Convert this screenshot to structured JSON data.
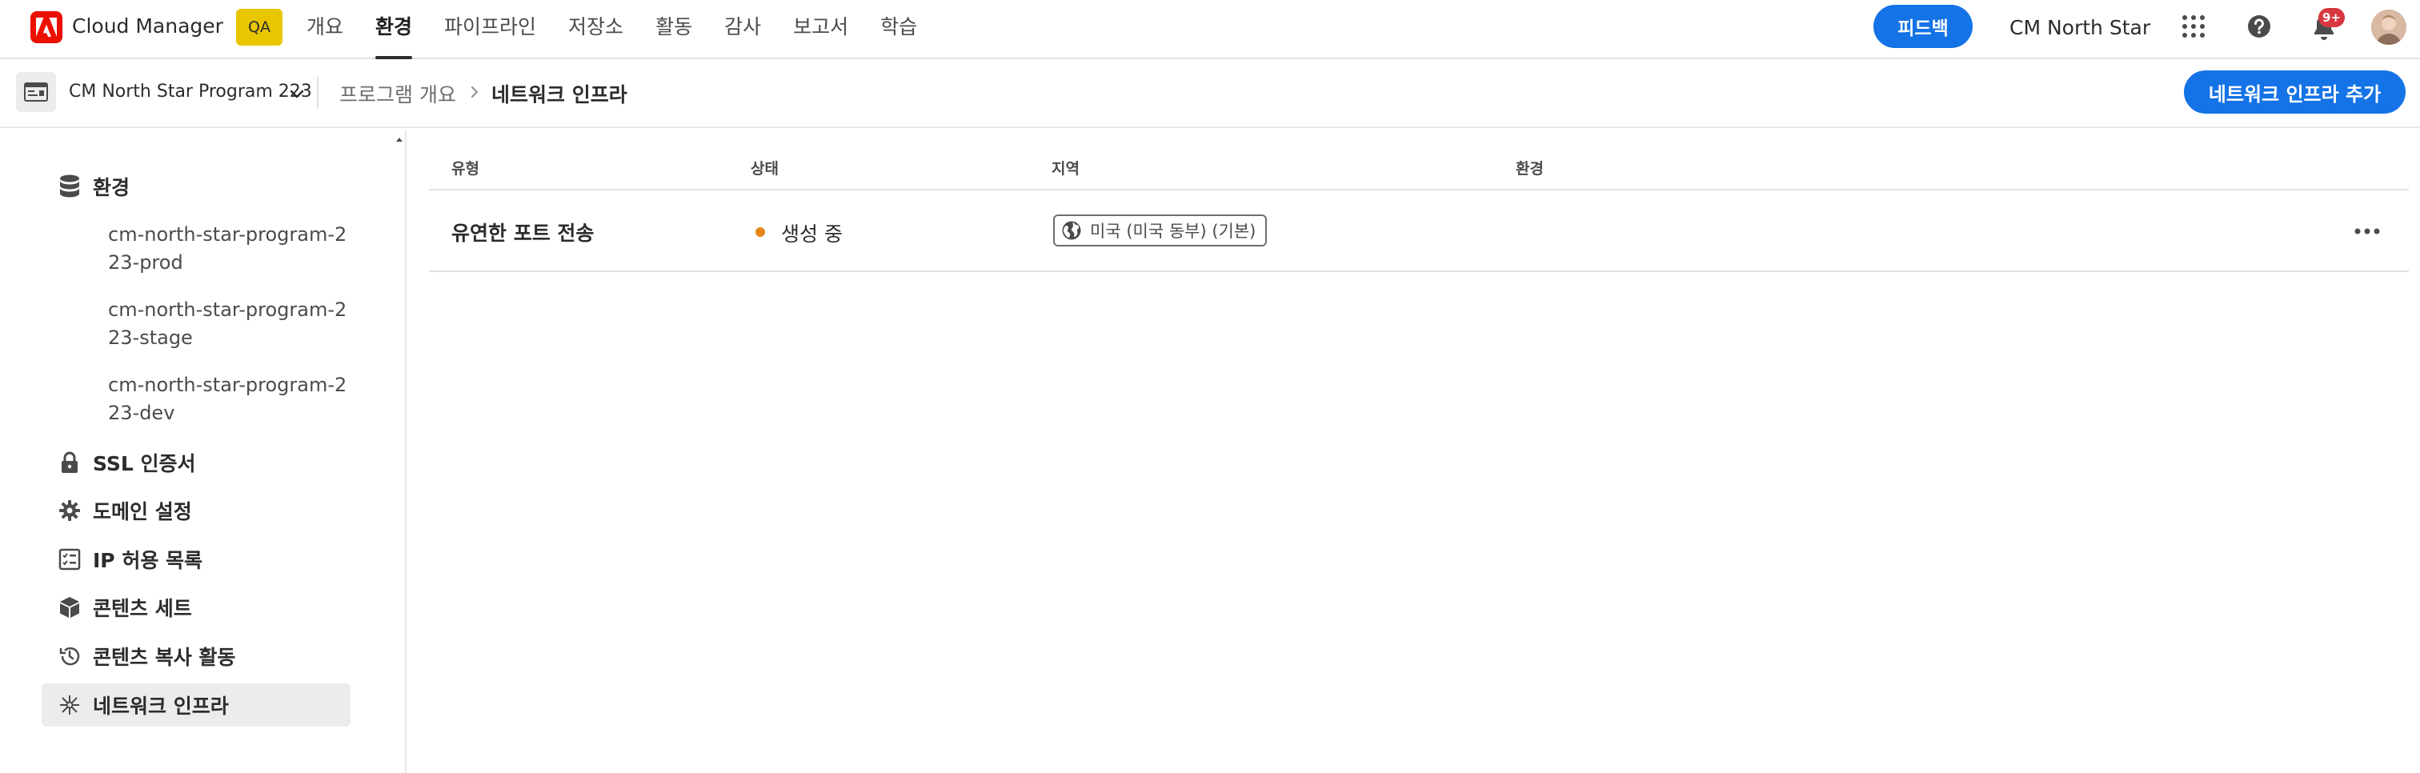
{
  "app": {
    "title": "Cloud Manager",
    "env_badge": "QA"
  },
  "nav": {
    "tabs": [
      {
        "label": "개요"
      },
      {
        "label": "환경"
      },
      {
        "label": "파이프라인"
      },
      {
        "label": "저장소"
      },
      {
        "label": "활동"
      },
      {
        "label": "감사"
      },
      {
        "label": "보고서"
      },
      {
        "label": "학습"
      }
    ],
    "active": "환경"
  },
  "header": {
    "feedback_label": "피드백",
    "org_name": "CM North Star",
    "notification_count": "9+",
    "brand_color": "#1473e6"
  },
  "subbar": {
    "program_name": "CM North Star Program 223",
    "breadcrumb": [
      "프로그램 개요",
      "네트워크 인프라"
    ],
    "add_button_label": "네트워크 인프라 추가"
  },
  "sidebar": {
    "environments_label": "환경",
    "environments": [
      "cm-north-star-program-223-prod",
      "cm-north-star-program-223-stage",
      "cm-north-star-program-223-dev"
    ],
    "items": [
      {
        "label": "SSL 인증서",
        "icon": "lock-icon"
      },
      {
        "label": "도메인 설정",
        "icon": "gear-icon"
      },
      {
        "label": "IP 허용 목록",
        "icon": "checklist-icon"
      },
      {
        "label": "콘텐츠 세트",
        "icon": "box-icon"
      },
      {
        "label": "콘텐츠 복사 활동",
        "icon": "history-icon"
      },
      {
        "label": "네트워크 인프라",
        "icon": "network-icon",
        "active": true
      }
    ]
  },
  "table": {
    "columns": [
      "유형",
      "상태",
      "지역",
      "환경"
    ],
    "rows": [
      {
        "type": "유연한 포트 전송",
        "status": "생성 중",
        "status_color": "#e68619",
        "region": "미국 (미국 동부) (기본)",
        "environment": ""
      }
    ]
  }
}
